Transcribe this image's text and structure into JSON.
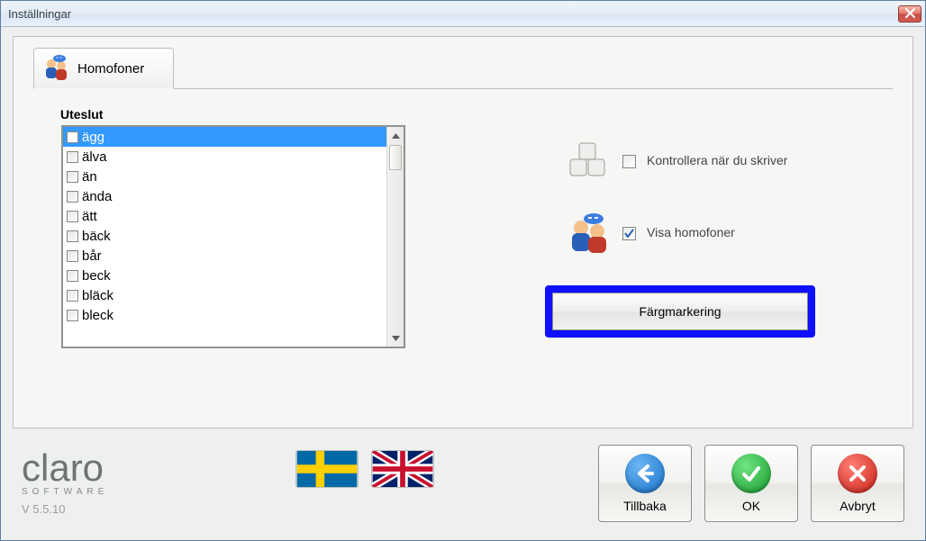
{
  "window": {
    "title": "Inställningar"
  },
  "tab": {
    "label": "Homofoner"
  },
  "uteslut": {
    "label": "Uteslut",
    "items": [
      {
        "text": "ägg",
        "checked": false,
        "selected": true
      },
      {
        "text": "älva",
        "checked": false,
        "selected": false
      },
      {
        "text": "än",
        "checked": false,
        "selected": false
      },
      {
        "text": "ända",
        "checked": false,
        "selected": false
      },
      {
        "text": "ätt",
        "checked": false,
        "selected": false
      },
      {
        "text": "bäck",
        "checked": false,
        "selected": false
      },
      {
        "text": "bår",
        "checked": false,
        "selected": false
      },
      {
        "text": "beck",
        "checked": false,
        "selected": false
      },
      {
        "text": "bläck",
        "checked": false,
        "selected": false
      },
      {
        "text": "bleck",
        "checked": false,
        "selected": false
      }
    ]
  },
  "options": {
    "check_while_typing": {
      "label": "Kontrollera när du skriver",
      "checked": false
    },
    "show_homophones": {
      "label": "Visa homofoner",
      "checked": true
    }
  },
  "highlight_button": {
    "label": "Färgmarkering"
  },
  "logo": {
    "brand": "claro",
    "subtitle": "SOFTWARE",
    "version": "V 5.5.10"
  },
  "actions": {
    "back": {
      "label": "Tillbaka"
    },
    "ok": {
      "label": "OK"
    },
    "cancel": {
      "label": "Avbryt"
    }
  }
}
